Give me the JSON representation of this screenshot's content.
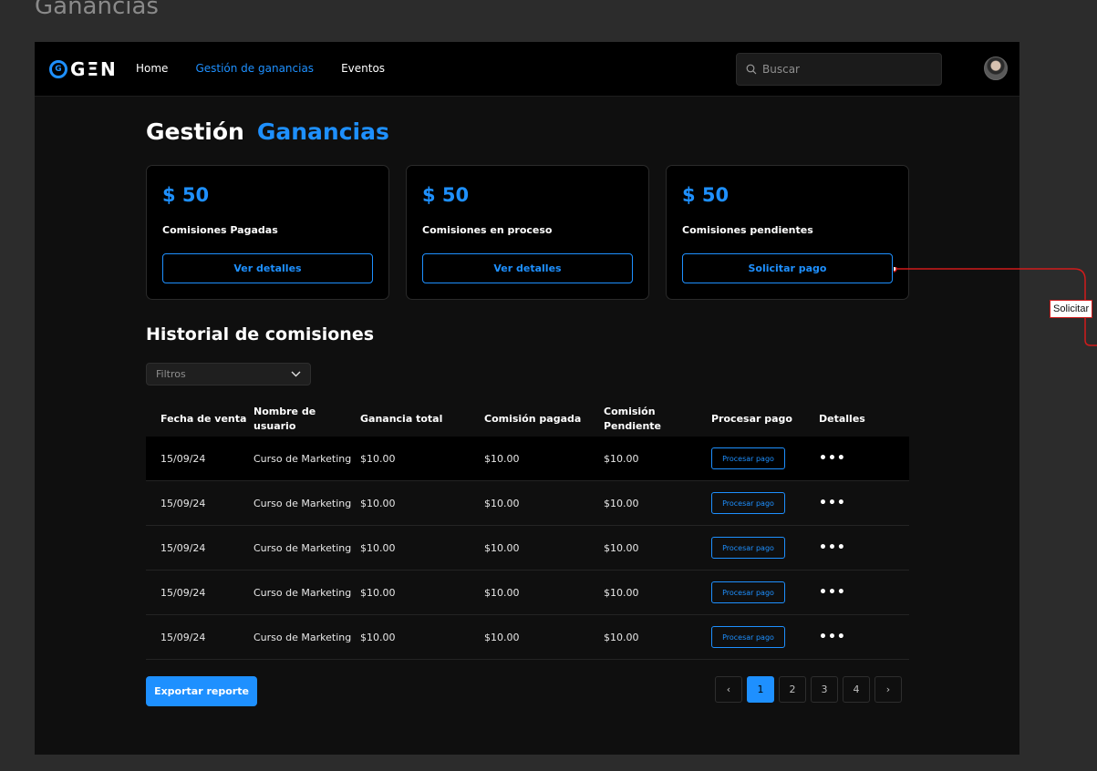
{
  "canvas": {
    "title": "Ganancias"
  },
  "app": {
    "logo_mark": "G",
    "logo_text": "GΞN",
    "nav": [
      {
        "label": "Home",
        "active": false
      },
      {
        "label": "Gestión de ganancias",
        "active": true
      },
      {
        "label": "Eventos",
        "active": false
      }
    ],
    "search": {
      "placeholder": "Buscar",
      "value": ""
    }
  },
  "page": {
    "title_part1": "Gestión",
    "title_part2": "Ganancias"
  },
  "cards": [
    {
      "amount": "$ 50",
      "label": "Comisiones Pagadas",
      "button": "Ver detalles"
    },
    {
      "amount": "$ 50",
      "label": "Comisiones en proceso",
      "button": "Ver detalles"
    },
    {
      "amount": "$ 50",
      "label": "Comisiones pendientes",
      "button": "Solicitar pago"
    }
  ],
  "history": {
    "title": "Historial de comisiones",
    "filter_label": "Filtros",
    "columns": [
      "Fecha de venta",
      "Nombre de usuario",
      "Ganancia total",
      "Comisión pagada",
      "Comisión Pendiente",
      "Procesar pago",
      "Detalles"
    ],
    "rows": [
      {
        "fecha": "15/09/24",
        "usuario": "Curso de Marketing",
        "ganancia": "$10.00",
        "pagada": "$10.00",
        "pendiente": "$10.00",
        "accion": "Procesar pago",
        "detalles": "•••"
      },
      {
        "fecha": "15/09/24",
        "usuario": "Curso de Marketing",
        "ganancia": "$10.00",
        "pagada": "$10.00",
        "pendiente": "$10.00",
        "accion": "Procesar pago",
        "detalles": "•••"
      },
      {
        "fecha": "15/09/24",
        "usuario": "Curso de Marketing",
        "ganancia": "$10.00",
        "pagada": "$10.00",
        "pendiente": "$10.00",
        "accion": "Procesar pago",
        "detalles": "•••"
      },
      {
        "fecha": "15/09/24",
        "usuario": "Curso de Marketing",
        "ganancia": "$10.00",
        "pagada": "$10.00",
        "pendiente": "$10.00",
        "accion": "Procesar pago",
        "detalles": "•••"
      },
      {
        "fecha": "15/09/24",
        "usuario": "Curso de Marketing",
        "ganancia": "$10.00",
        "pagada": "$10.00",
        "pendiente": "$10.00",
        "accion": "Procesar pago",
        "detalles": "•••"
      }
    ],
    "export_label": "Exportar reporte",
    "pagination": {
      "prev": "‹",
      "next": "›",
      "pages": [
        "1",
        "2",
        "3",
        "4"
      ],
      "current": "1"
    }
  },
  "annotation": {
    "label": "Solicitar"
  },
  "colors": {
    "accent": "#1e90ff",
    "background": "#0f0f0f",
    "canvas": "#2c2c2c",
    "annotation": "#d11b1b"
  },
  "icons": {
    "search": "search-icon",
    "filter_toggle": "chevron-down-icon",
    "prev": "chevron-left-icon",
    "next": "chevron-right-icon",
    "more": "more-horizontal-icon"
  }
}
